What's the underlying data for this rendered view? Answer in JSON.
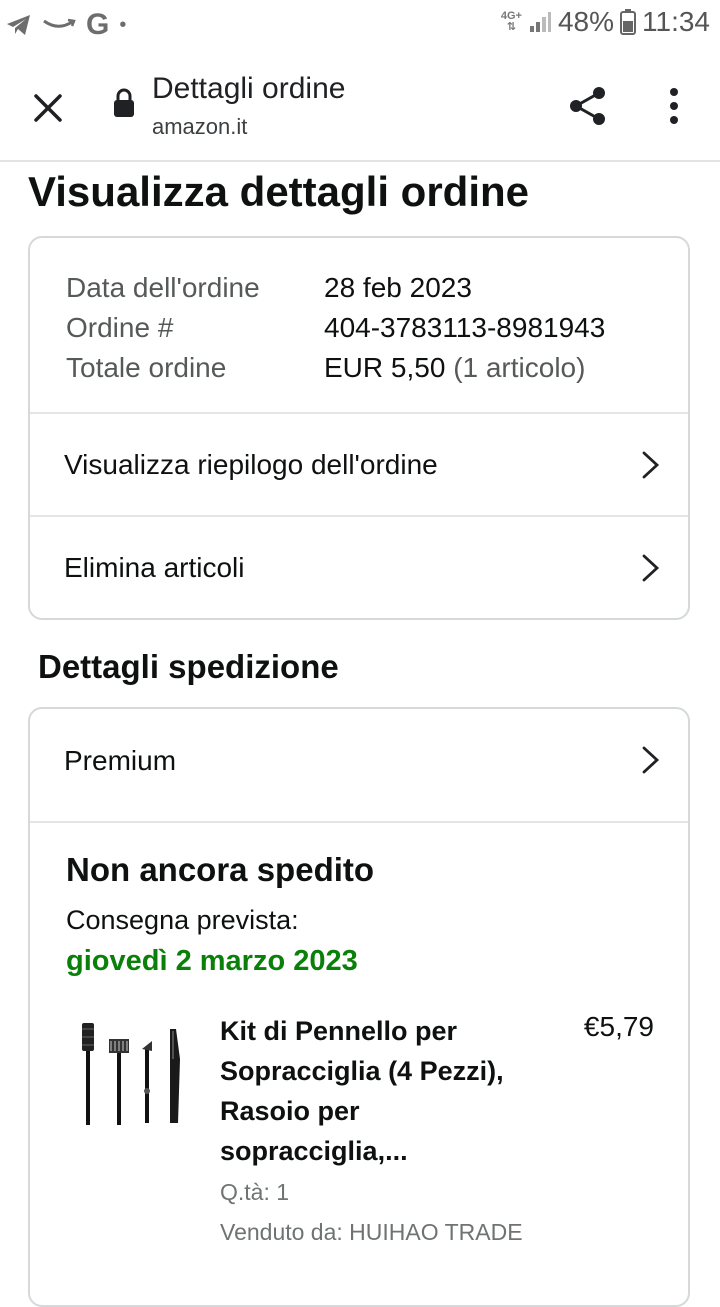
{
  "status_bar": {
    "network": "4G+",
    "battery": "48%",
    "time": "11:34",
    "left_icons": [
      "telegram-icon",
      "amazon-smile-icon",
      "google-icon",
      "dot-icon"
    ]
  },
  "browser_bar": {
    "title": "Dettagli ordine",
    "url": "amazon.it"
  },
  "page": {
    "title": "Visualizza dettagli ordine"
  },
  "order_info": {
    "date_label": "Data dell'ordine",
    "date_value": "28 feb 2023",
    "number_label": "Ordine #",
    "number_value": "404-3783113-8981943",
    "total_label": "Totale ordine",
    "total_value": "EUR 5,50",
    "total_items": "(1 articolo)"
  },
  "order_actions": [
    {
      "label": "Visualizza riepilogo dell'ordine"
    },
    {
      "label": "Elimina articoli"
    }
  ],
  "shipping": {
    "section_title": "Dettagli spedizione",
    "method": "Premium",
    "status": "Non ancora spedito",
    "delivery_label": "Consegna prevista:",
    "delivery_date": "giovedì 2 marzo 2023",
    "status_color": "#0a7f0a"
  },
  "product": {
    "name": "Kit di Pennello per Sopracciglia (4 Pezzi), Rasoio per sopracciglia,...",
    "price": "€5,79",
    "quantity": "Q.tà: 1",
    "seller": "Venduto da: HUIHAO TRADE"
  }
}
